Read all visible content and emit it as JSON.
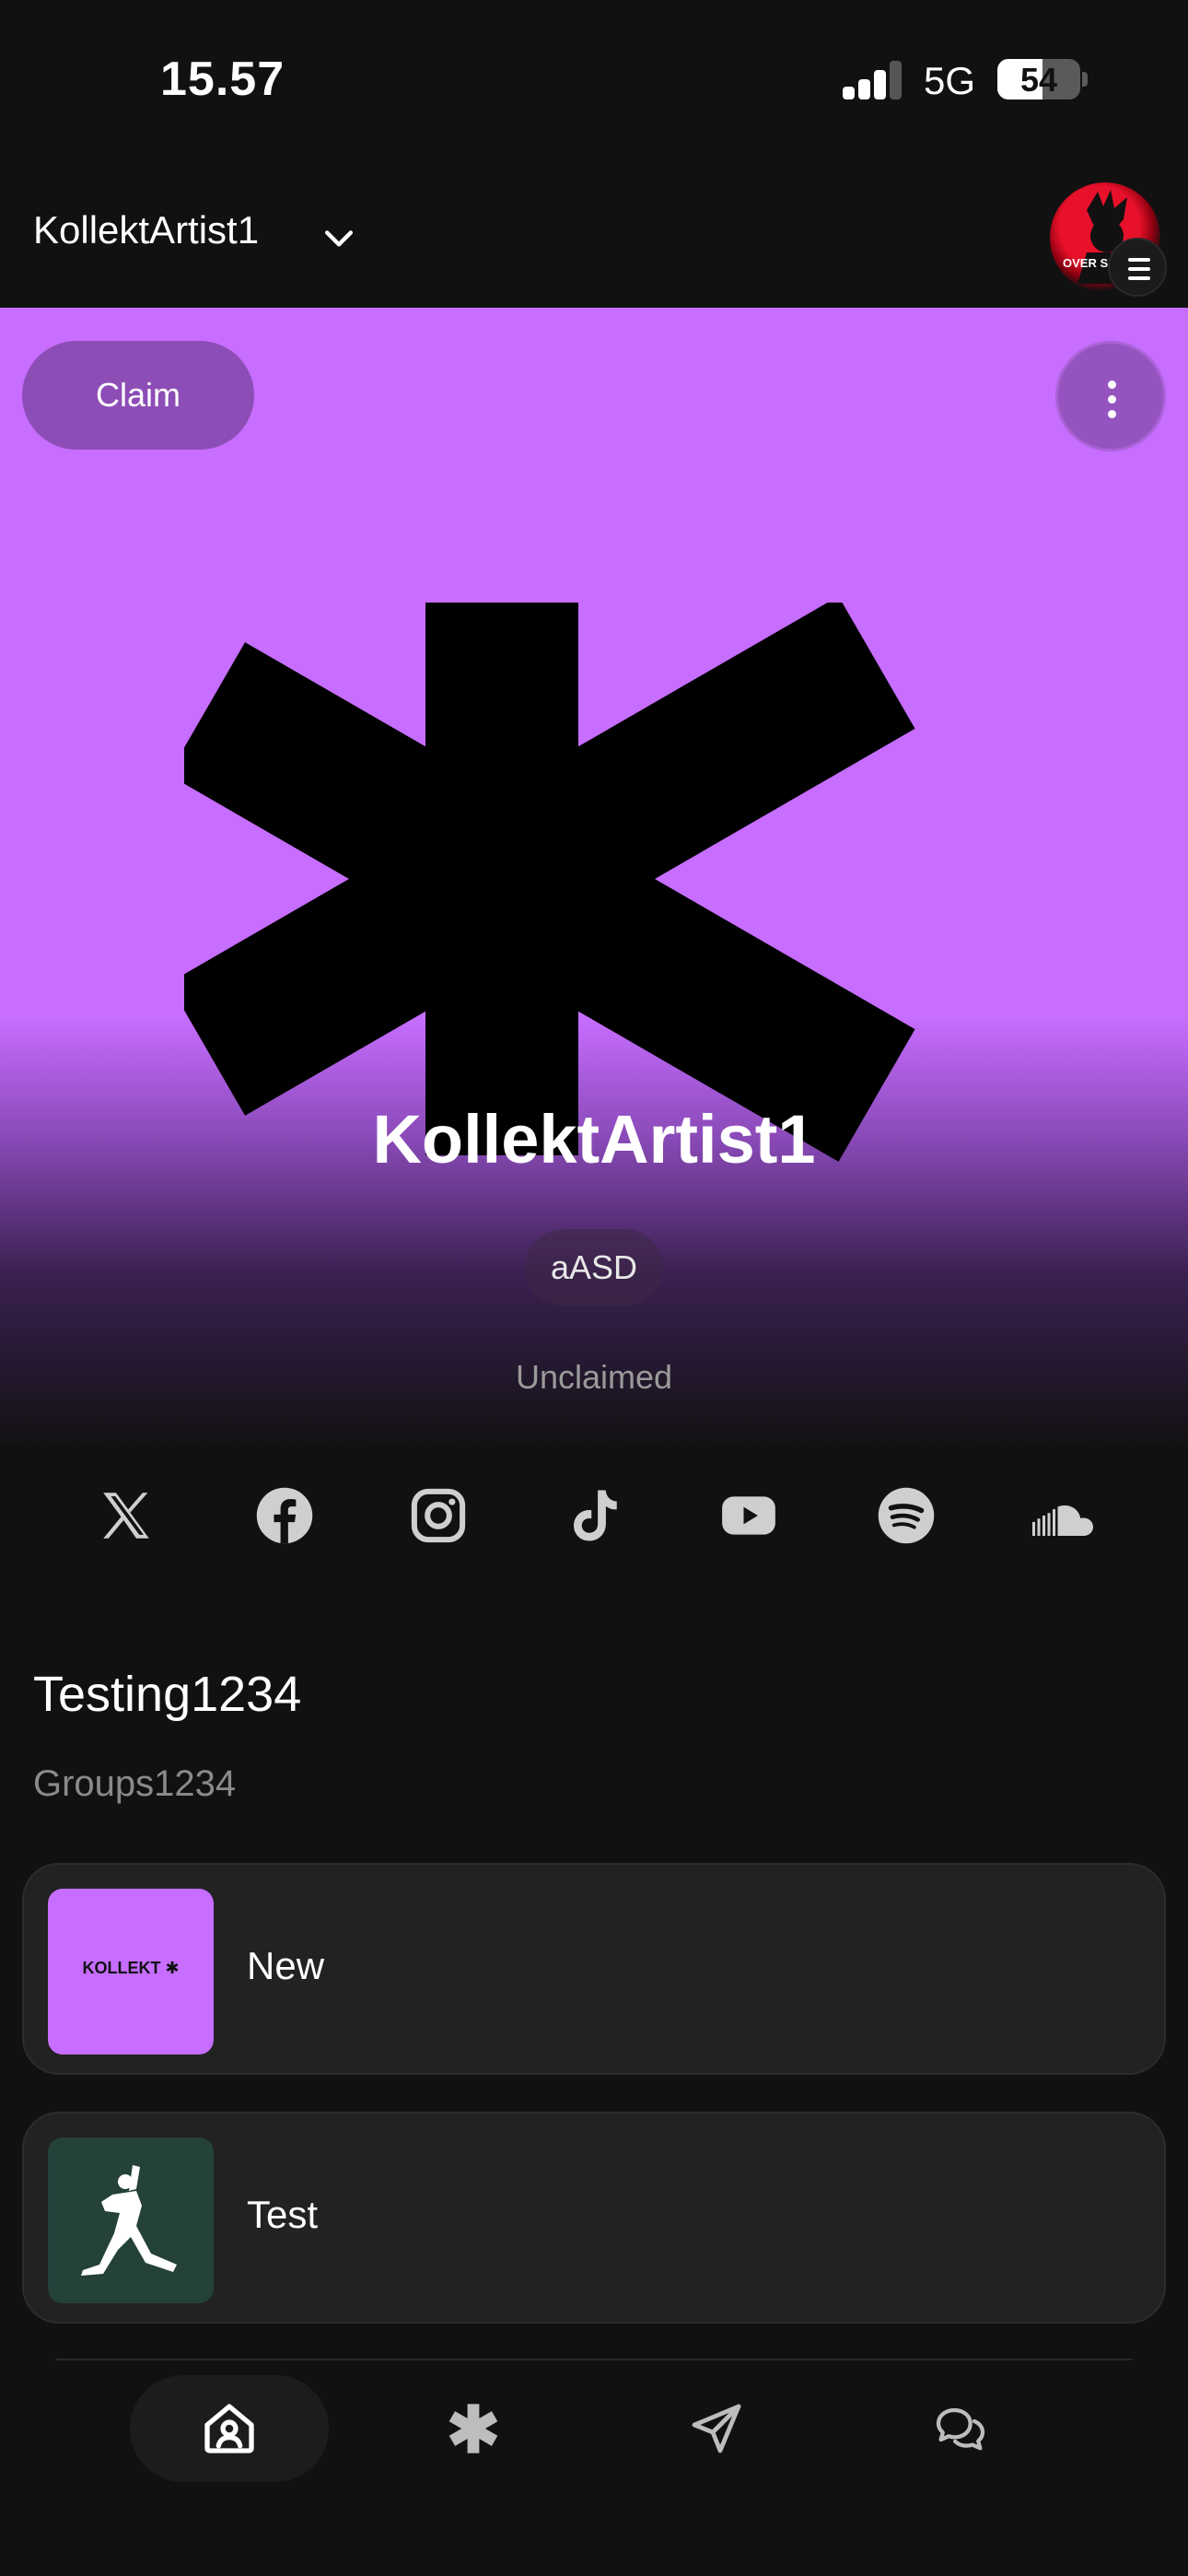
{
  "status_bar": {
    "time": "15.57",
    "network": "5G",
    "battery": "54",
    "battery_level": 0.54
  },
  "header": {
    "account_name": "KollektArtist1",
    "icons": [
      "chevron-down-icon",
      "avatar",
      "hamburger-menu-icon"
    ]
  },
  "hero": {
    "claim_label": "Claim",
    "artist_name": "KollektArtist1",
    "tag": "aASD",
    "claim_status": "Unclaimed",
    "background_color": "#c76dff",
    "logo_icon": "asterisk-logo-icon"
  },
  "socials": [
    "x-icon",
    "facebook-icon",
    "instagram-icon",
    "tiktok-icon",
    "youtube-icon",
    "spotify-icon",
    "soundcloud-icon"
  ],
  "groups": {
    "title": "Testing1234",
    "subtitle": "Groups1234",
    "items": [
      {
        "label": "New",
        "thumb_text": "KOLLEKT ✱",
        "thumb_color": "#c76dff"
      },
      {
        "label": "Test",
        "thumb_icon": "jumpman-logo-icon",
        "thumb_color": "#24413a"
      }
    ]
  },
  "bottom_nav": {
    "items": [
      {
        "name": "home",
        "icon": "home-user-icon",
        "active": true
      },
      {
        "name": "kollekt",
        "icon": "asterisk-icon",
        "active": false
      },
      {
        "name": "send",
        "icon": "paper-plane-icon",
        "active": false
      },
      {
        "name": "chat",
        "icon": "chat-bubbles-icon",
        "active": false
      }
    ]
  },
  "colors": {
    "background": "#111111",
    "card": "#222222",
    "accent": "#c76dff",
    "muted_text": "#8a8a8a"
  }
}
